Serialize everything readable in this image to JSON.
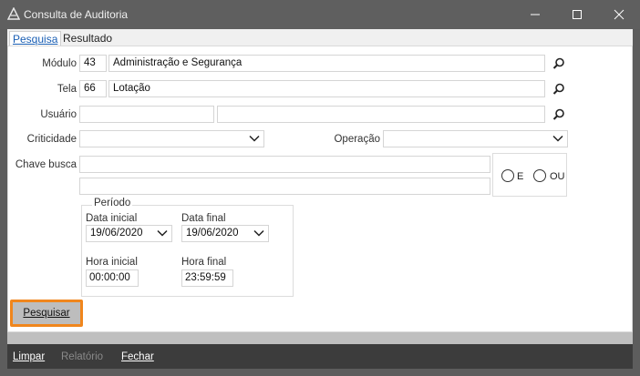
{
  "window": {
    "title": "Consulta de Auditoria"
  },
  "tabs": [
    {
      "label": "Pesquisa",
      "active": true
    },
    {
      "label": "Resultado",
      "active": false
    }
  ],
  "form": {
    "modulo": {
      "label": "Módulo",
      "code": "43",
      "name": "Administração e Segurança"
    },
    "tela": {
      "label": "Tela",
      "code": "66",
      "name": "Lotação"
    },
    "usuario": {
      "label": "Usuário",
      "code": "",
      "name": ""
    },
    "criticidade": {
      "label": "Criticidade",
      "value": ""
    },
    "operacao": {
      "label": "Operação",
      "value": ""
    },
    "chave_busca": {
      "label": "Chave busca",
      "value1": "",
      "value2": ""
    },
    "logic": {
      "e": "E",
      "ou": "OU"
    },
    "periodo": {
      "legend": "Período",
      "data_inicial_label": "Data inicial",
      "data_inicial": "19/06/2020",
      "data_final_label": "Data final",
      "data_final": "19/06/2020",
      "hora_inicial_label": "Hora inicial",
      "hora_inicial": "00:00:00",
      "hora_final_label": "Hora final",
      "hora_final": "23:59:59"
    },
    "search_button": "Pesquisar"
  },
  "bottom_bar": {
    "limpar": "Limpar",
    "relatorio": "Relatório",
    "fechar": "Fechar"
  }
}
